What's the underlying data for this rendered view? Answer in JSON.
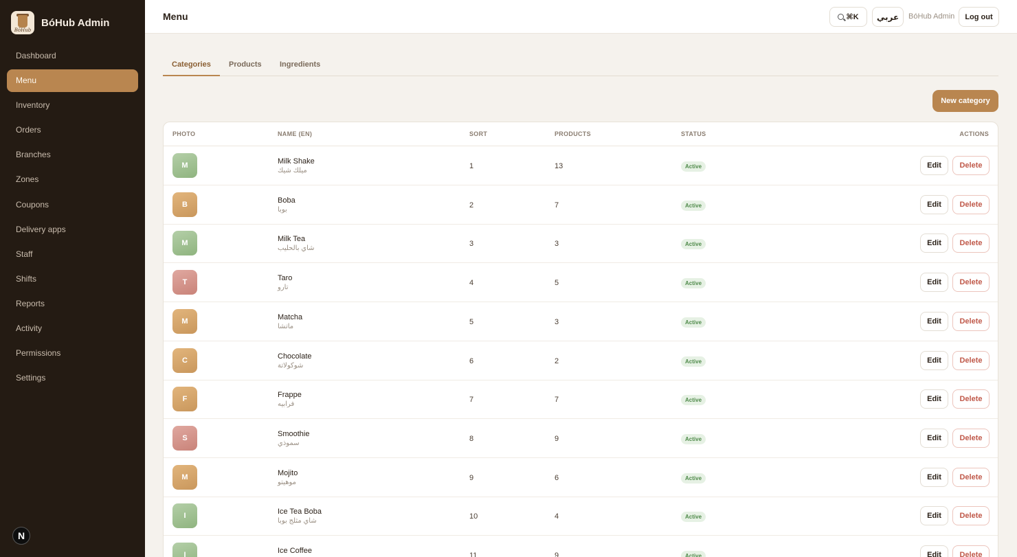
{
  "brand": {
    "name": "BóHub Admin",
    "logo_text": "BōHub"
  },
  "sidebar": {
    "items": [
      {
        "label": "Dashboard",
        "active": false
      },
      {
        "label": "Menu",
        "active": true
      },
      {
        "label": "Inventory",
        "active": false
      },
      {
        "label": "Orders",
        "active": false
      },
      {
        "label": "Branches",
        "active": false
      },
      {
        "label": "Zones",
        "active": false
      },
      {
        "label": "Coupons",
        "active": false
      },
      {
        "label": "Delivery apps",
        "active": false
      },
      {
        "label": "Staff",
        "active": false
      },
      {
        "label": "Shifts",
        "active": false
      },
      {
        "label": "Reports",
        "active": false
      },
      {
        "label": "Activity",
        "active": false
      },
      {
        "label": "Permissions",
        "active": false
      },
      {
        "label": "Settings",
        "active": false
      }
    ],
    "badge": "N"
  },
  "header": {
    "title": "Menu",
    "search_shortcut": "⌘K",
    "language": "عربي",
    "user": "BóHub Admin",
    "logout": "Log out"
  },
  "tabs": [
    {
      "label": "Categories",
      "active": true
    },
    {
      "label": "Products",
      "active": false
    },
    {
      "label": "Ingredients",
      "active": false
    }
  ],
  "new_button": "New category",
  "table": {
    "columns": [
      "PHOTO",
      "NAME (EN)",
      "SORT",
      "PRODUCTS",
      "STATUS",
      "ACTIONS"
    ],
    "edit_label": "Edit",
    "delete_label": "Delete",
    "rows": [
      {
        "initial": "M",
        "color": "green",
        "name_en": "Milk Shake",
        "name_ar": "ميلك شيك",
        "sort": "1",
        "products": "13",
        "status": "Active"
      },
      {
        "initial": "B",
        "color": "tan",
        "name_en": "Boba",
        "name_ar": "بوبا",
        "sort": "2",
        "products": "7",
        "status": "Active"
      },
      {
        "initial": "M",
        "color": "green",
        "name_en": "Milk Tea",
        "name_ar": "شاي بالحليب",
        "sort": "3",
        "products": "3",
        "status": "Active"
      },
      {
        "initial": "T",
        "color": "rose",
        "name_en": "Taro",
        "name_ar": "تارو",
        "sort": "4",
        "products": "5",
        "status": "Active"
      },
      {
        "initial": "M",
        "color": "tan",
        "name_en": "Matcha",
        "name_ar": "ماتشا",
        "sort": "5",
        "products": "3",
        "status": "Active"
      },
      {
        "initial": "C",
        "color": "tan",
        "name_en": "Chocolate",
        "name_ar": "شوكولاتة",
        "sort": "6",
        "products": "2",
        "status": "Active"
      },
      {
        "initial": "F",
        "color": "tan",
        "name_en": "Frappe",
        "name_ar": "فرابيه",
        "sort": "7",
        "products": "7",
        "status": "Active"
      },
      {
        "initial": "S",
        "color": "rose",
        "name_en": "Smoothie",
        "name_ar": "سموذي",
        "sort": "8",
        "products": "9",
        "status": "Active"
      },
      {
        "initial": "M",
        "color": "tan",
        "name_en": "Mojito",
        "name_ar": "موهيتو",
        "sort": "9",
        "products": "6",
        "status": "Active"
      },
      {
        "initial": "I",
        "color": "green",
        "name_en": "Ice Tea Boba",
        "name_ar": "شاي مثلج بوبا",
        "sort": "10",
        "products": "4",
        "status": "Active"
      },
      {
        "initial": "I",
        "color": "green",
        "name_en": "Ice Coffee",
        "name_ar": "",
        "sort": "11",
        "products": "9",
        "status": "Active"
      }
    ]
  }
}
